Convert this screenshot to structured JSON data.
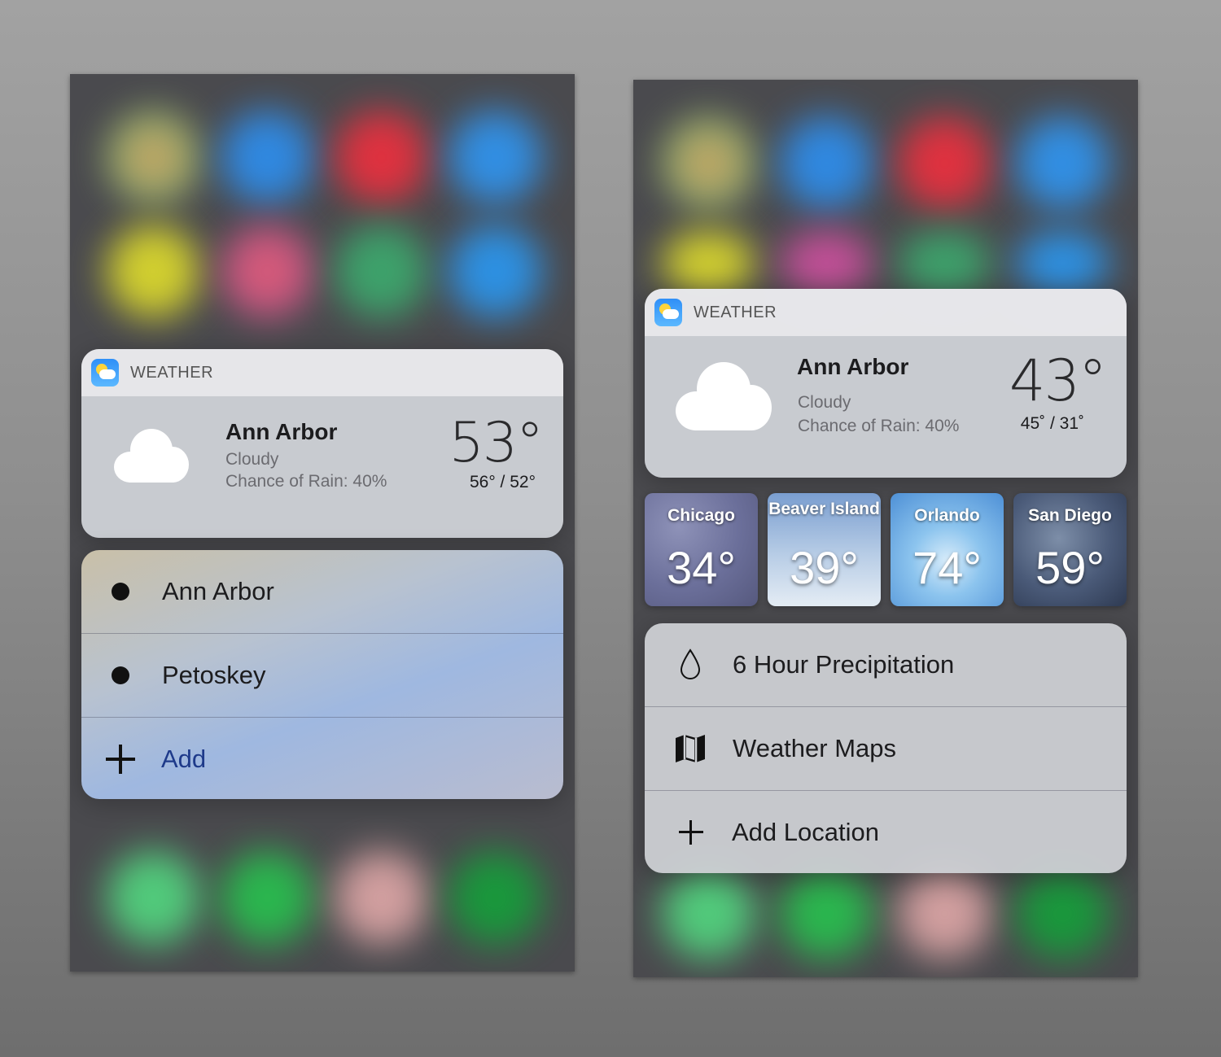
{
  "left_panel": {
    "widget": {
      "app_name": "WEATHER",
      "city": "Ann Arbor",
      "condition": "Cloudy",
      "rain": "Chance of Rain: 40%",
      "temp": "53°",
      "hilo": "56° / 52°"
    },
    "menu": [
      {
        "label": "Ann Arbor",
        "icon": "bullet-icon"
      },
      {
        "label": "Petoskey",
        "icon": "bullet-icon"
      },
      {
        "label": "Add",
        "icon": "plus-icon"
      }
    ]
  },
  "right_panel": {
    "widget": {
      "app_name": "WEATHER",
      "city": "Ann Arbor",
      "condition": "Cloudy",
      "rain": "Chance of Rain: 40%",
      "temp": "43°",
      "hilo": "45˚ / 31˚"
    },
    "tiles": [
      {
        "name": "Chicago",
        "temp": "34°"
      },
      {
        "name": "Beaver Island",
        "temp": "39°"
      },
      {
        "name": "Orlando",
        "temp": "74°"
      },
      {
        "name": "San Diego",
        "temp": "59°"
      }
    ],
    "menu": [
      {
        "label": "6 Hour Precipitation",
        "icon": "raindrop-icon"
      },
      {
        "label": "Weather Maps",
        "icon": "map-icon"
      },
      {
        "label": "Add Location",
        "icon": "plus-icon"
      }
    ]
  },
  "colors": {
    "accent_blue": "#1e3a8a",
    "tile_snow": "#6b6f9a",
    "tile_sky": "#5aa0e0",
    "tile_storm": "#3a4a66"
  }
}
